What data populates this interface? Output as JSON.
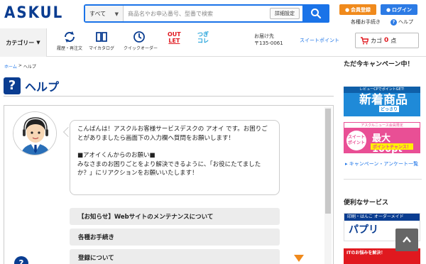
{
  "header": {
    "logo": "ASKUL",
    "search": {
      "scope": "すべて",
      "placeholder": "商品名やお申込番号、型番で検索",
      "advanced_label": "詳細設定"
    },
    "member_register": "会員登録",
    "login": "ログイン",
    "procedures_link": "各種お手続き",
    "help_link": "ヘルプ"
  },
  "nav": {
    "category": "カテゴリー",
    "items": [
      {
        "label": "履歴・再注文",
        "icon": "refresh-icon"
      },
      {
        "label": "マイカタログ",
        "icon": "book-icon"
      },
      {
        "label": "クイックオーダー",
        "icon": "clock-icon"
      }
    ],
    "outlet_line1": "OUT",
    "outlet_line2": "LET",
    "tsugi_line1": "つぎ",
    "tsugi_line2": "コレ",
    "delivery_label": "お届け先",
    "delivery_zip": "〒135-0061",
    "sweet_point": "スイートポイント",
    "cart_label": "カゴ",
    "cart_count": "0",
    "cart_unit": "点"
  },
  "breadcrumb": {
    "home": "ホーム",
    "separator": ">",
    "current": "ヘルプ"
  },
  "page": {
    "title_icon": "?",
    "title": "ヘルプ"
  },
  "chat": {
    "message_line1": "こんばんは！アスクルお客様サービスデスクの アオイ です。お困りごとがありましたら画面下の入力欄へ質問をお願いします！",
    "message_line2": "■アオイくんからのお願い■",
    "message_line3": "みなさまのお困りごとをより解決できるように、「お役にたてましたか？」にリアクションをお願いいたします！",
    "options": [
      "【お知らせ】Webサイトのメンテナンスについて",
      "各種お手続き",
      "登録について"
    ]
  },
  "sidebar": {
    "campaign_title": "ただ今キャンペーン中！",
    "banner1_top": "レビューCPでポイントGET!",
    "banner1_big": "新着商品",
    "banner1_small": "どっさり",
    "banner2_top": "アスクルニュース会員限定",
    "banner2_circle": "スイート ポイント",
    "banner2_pt": "最大100pt",
    "banner2_chance": "ポイントチャンス！",
    "campaign_link": "キャンペーン・アンケート一覧",
    "services_title": "便利なサービス",
    "banner3_top": "印刷・はんこ オーダーメイド",
    "banner3_big": "パプリ",
    "banner4_text": "ITのお悩みを解決！"
  },
  "colors": {
    "brand_navy": "#0a3d91",
    "accent_blue": "#1a73e8",
    "orange": "#f08a1c",
    "outlet_red": "#e0191f"
  }
}
